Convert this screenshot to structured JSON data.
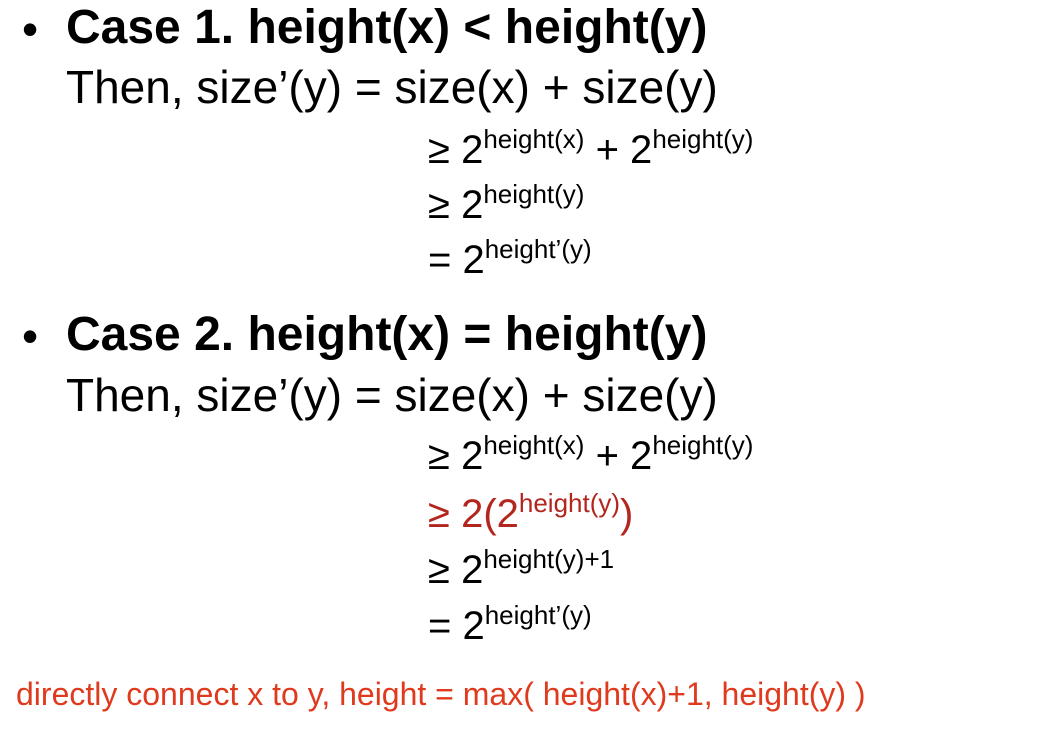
{
  "case1": {
    "bullet": "•",
    "title": "Case 1. height(x) < height(y)",
    "then": "Then, size’(y) = size(x) + size(y)",
    "steps": [
      {
        "rel": "≥ 2",
        "sup1": "height(x)",
        "mid": " + 2",
        "sup2": "height(y)",
        "tail": ""
      },
      {
        "rel": "≥ 2",
        "sup1": "height(y)",
        "mid": "",
        "sup2": "",
        "tail": ""
      },
      {
        "rel": "= 2",
        "sup1": "height’(y)",
        "mid": "",
        "sup2": "",
        "tail": ""
      }
    ]
  },
  "case2": {
    "bullet": "•",
    "title": "Case 2. height(x) = height(y)",
    "then": "Then, size’(y) = size(x) + size(y)",
    "steps": [
      {
        "rel": "≥ 2",
        "sup1": "height(x)",
        "mid": " + 2",
        "sup2": "height(y)",
        "tail": ""
      },
      {
        "rel": "≥ 2(2",
        "sup1": "height(y)",
        "mid": "",
        "sup2": "",
        "tail": ")",
        "color": "#b3261e"
      },
      {
        "rel": "≥ 2",
        "sup1": "height(y)+1",
        "mid": "",
        "sup2": "",
        "tail": ""
      },
      {
        "rel": "= 2",
        "sup1": "height’(y)",
        "mid": "",
        "sup2": "",
        "tail": ""
      }
    ]
  },
  "note": {
    "text": "directly connect x to y, height = max( height(x)+1, height(y) )",
    "color": "#e03a1e"
  }
}
